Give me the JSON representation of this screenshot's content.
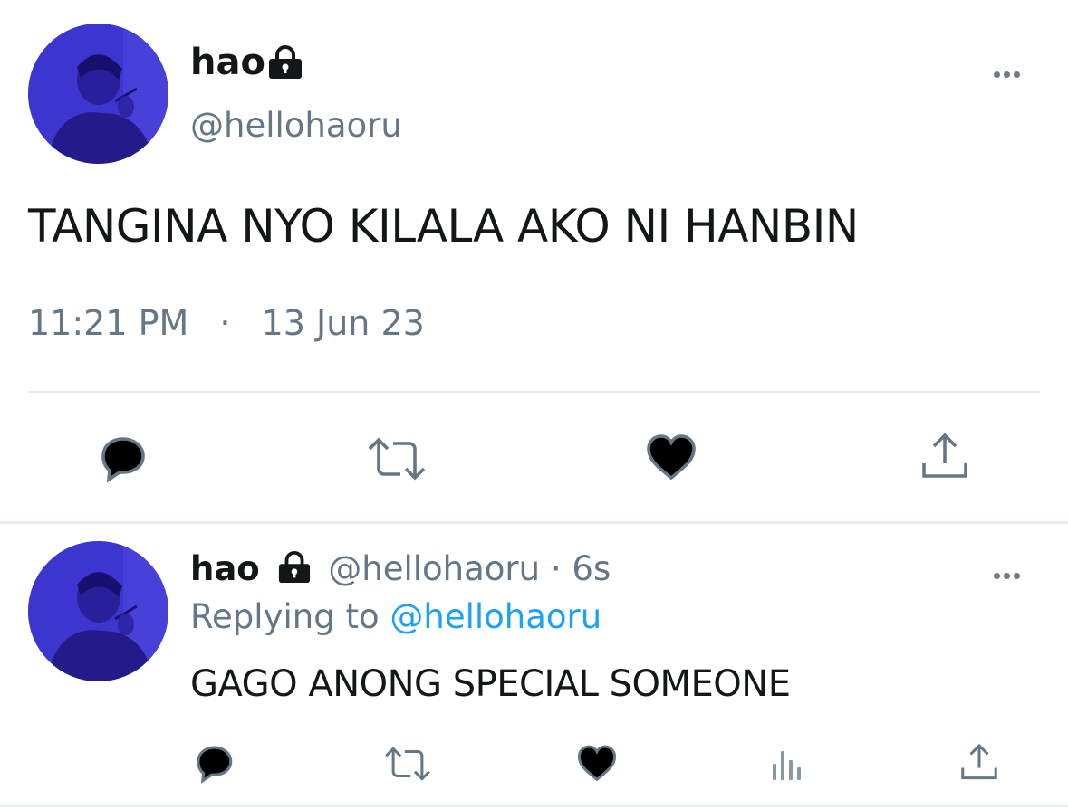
{
  "main_tweet": {
    "display_name": "hao",
    "handle": "@hellohaoru",
    "text": "TANGINA NYO KILALA AKO NI HANBIN",
    "time": "11:21 PM",
    "separator": "·",
    "date": "13 Jun 23",
    "actions": [
      "reply-icon",
      "retweet-icon",
      "like-icon",
      "share-icon"
    ]
  },
  "reply_tweet": {
    "display_name": "hao",
    "handle": "@hellohaoru",
    "age": "· 6s",
    "replying_prefix": "Replying to",
    "replying_handle": "@hellohaoru",
    "text": "GAGO ANONG SPECIAL SOMEONE",
    "actions": [
      "reply-icon",
      "retweet-icon",
      "like-icon",
      "analytics-icon",
      "share-icon"
    ]
  },
  "colors": {
    "text": "#14171a",
    "muted": "#657786",
    "link": "#1da1f2",
    "divider": "#e6ecf0",
    "avatar": "#3b34cf"
  }
}
